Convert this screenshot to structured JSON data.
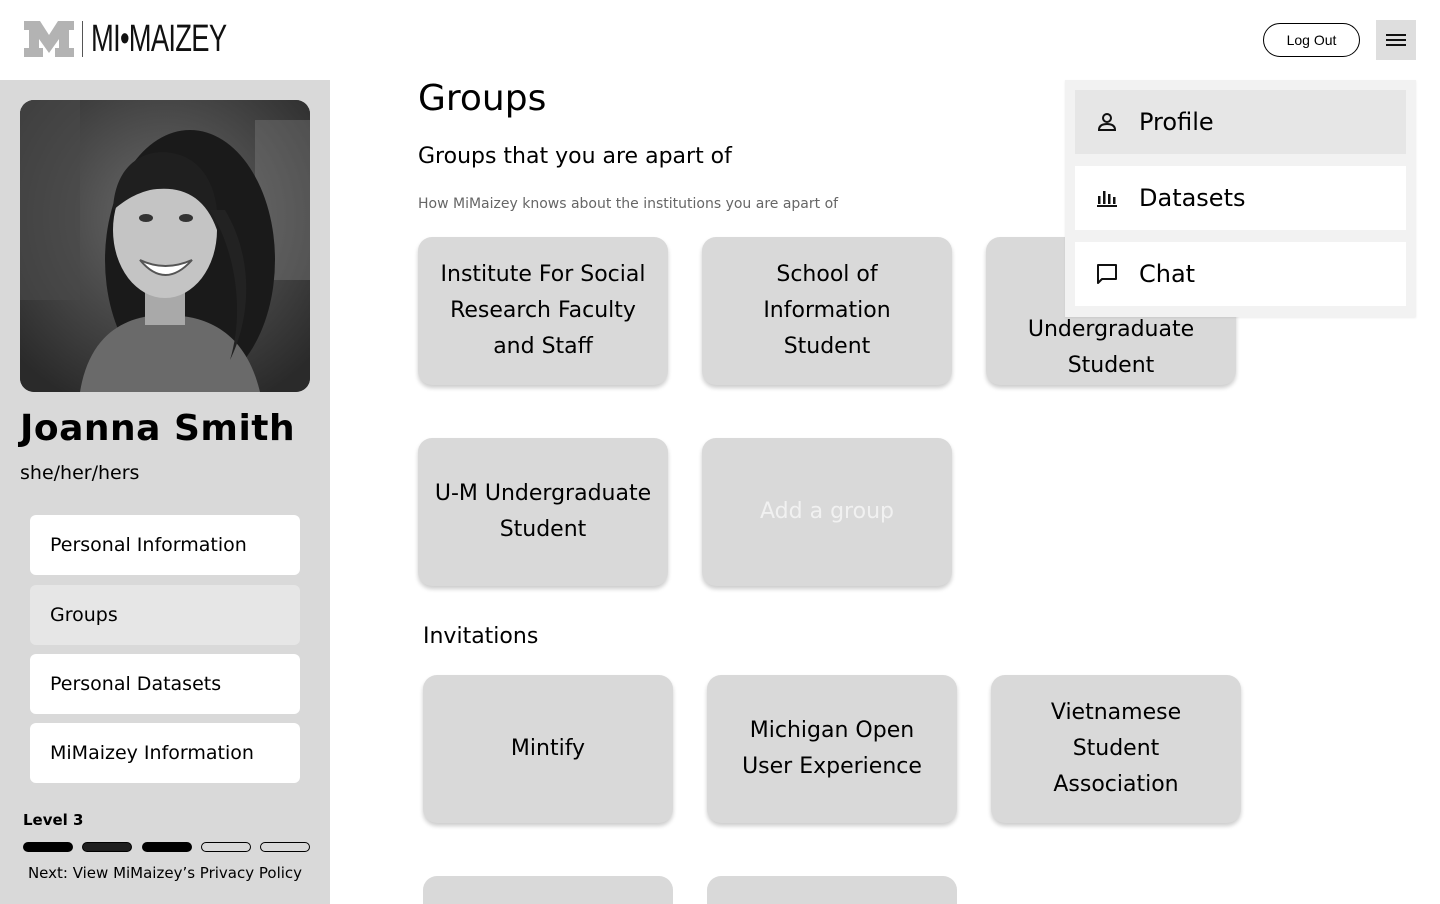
{
  "header": {
    "logo_text": "MI•MAIZEY",
    "logout_label": "Log Out",
    "menu_icon": "hamburger-icon"
  },
  "sidebar": {
    "user_name": "Joanna Smith",
    "pronouns": "she/her/hers",
    "nav": [
      {
        "label": "Personal Information"
      },
      {
        "label": "Groups",
        "active": true
      },
      {
        "label": "Personal Datasets"
      },
      {
        "label": "MiMaizey Information"
      }
    ],
    "level_label": "Level 3",
    "level": {
      "current": 3,
      "total": 5
    },
    "next_step": "Next: View MiMaizey’s Privacy Policy"
  },
  "main": {
    "title": "Groups",
    "subheading": "Groups that you are apart of",
    "helper": "How MiMaizey knows about the institutions you are apart of",
    "groups": [
      {
        "label": "Institute For Social Research Faculty and Staff"
      },
      {
        "label": "School of Information Student"
      },
      {
        "label": "Undergraduate Student"
      },
      {
        "label": "U-M Undergraduate Student"
      },
      {
        "label": "Add a group"
      }
    ],
    "invitations_title": "Invitations",
    "invitations": [
      {
        "label": "Mintify"
      },
      {
        "label": "Michigan Open User Experience"
      },
      {
        "label": "Vietnamese Student Association"
      }
    ]
  },
  "dropdown": {
    "items": [
      {
        "label": "Profile",
        "icon": "person-icon",
        "active": true
      },
      {
        "label": "Datasets",
        "icon": "bar-chart-icon"
      },
      {
        "label": "Chat",
        "icon": "chat-bubble-icon"
      }
    ]
  }
}
